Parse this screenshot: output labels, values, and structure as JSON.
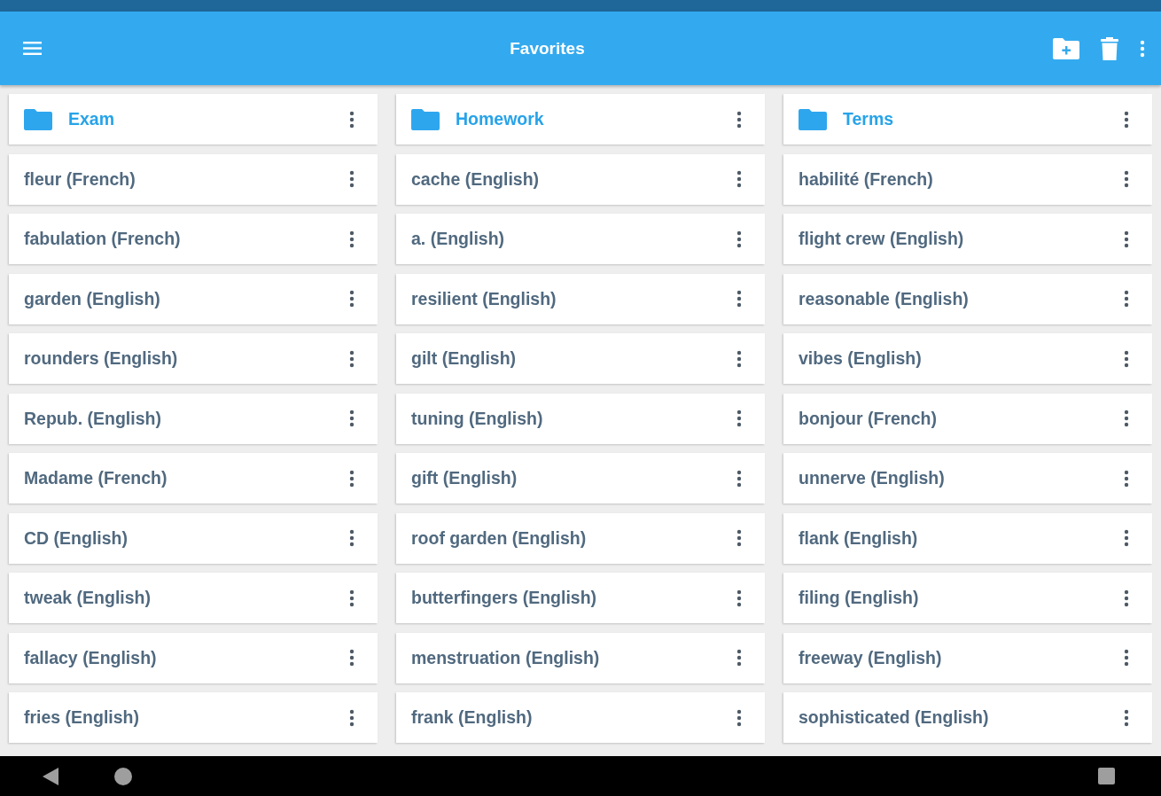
{
  "app_bar": {
    "title": "Favorites"
  },
  "columns": [
    {
      "items": [
        {
          "kind": "folder",
          "label": "Exam"
        },
        {
          "kind": "word",
          "label": "fleur (French)"
        },
        {
          "kind": "word",
          "label": "fabulation (French)"
        },
        {
          "kind": "word",
          "label": "garden (English)"
        },
        {
          "kind": "word",
          "label": "rounders (English)"
        },
        {
          "kind": "word",
          "label": "Repub. (English)"
        },
        {
          "kind": "word",
          "label": "Madame (French)"
        },
        {
          "kind": "word",
          "label": "CD (English)"
        },
        {
          "kind": "word",
          "label": "tweak (English)"
        },
        {
          "kind": "word",
          "label": "fallacy (English)"
        },
        {
          "kind": "word",
          "label": "fries (English)"
        }
      ]
    },
    {
      "items": [
        {
          "kind": "folder",
          "label": "Homework"
        },
        {
          "kind": "word",
          "label": "cache (English)"
        },
        {
          "kind": "word",
          "label": "a. (English)"
        },
        {
          "kind": "word",
          "label": "resilient (English)"
        },
        {
          "kind": "word",
          "label": "gilt (English)"
        },
        {
          "kind": "word",
          "label": "tuning (English)"
        },
        {
          "kind": "word",
          "label": "gift (English)"
        },
        {
          "kind": "word",
          "label": "roof garden (English)"
        },
        {
          "kind": "word",
          "label": "butterfingers (English)"
        },
        {
          "kind": "word",
          "label": "menstruation (English)"
        },
        {
          "kind": "word",
          "label": "frank (English)"
        }
      ]
    },
    {
      "items": [
        {
          "kind": "folder",
          "label": "Terms"
        },
        {
          "kind": "word",
          "label": "habilité (French)"
        },
        {
          "kind": "word",
          "label": "flight crew (English)"
        },
        {
          "kind": "word",
          "label": "reasonable (English)"
        },
        {
          "kind": "word",
          "label": "vibes (English)"
        },
        {
          "kind": "word",
          "label": "bonjour (French)"
        },
        {
          "kind": "word",
          "label": "unnerve (English)"
        },
        {
          "kind": "word",
          "label": "flank (English)"
        },
        {
          "kind": "word",
          "label": "filing (English)"
        },
        {
          "kind": "word",
          "label": "freeway (English)"
        },
        {
          "kind": "word",
          "label": "sophisticated (English)"
        }
      ]
    }
  ]
}
